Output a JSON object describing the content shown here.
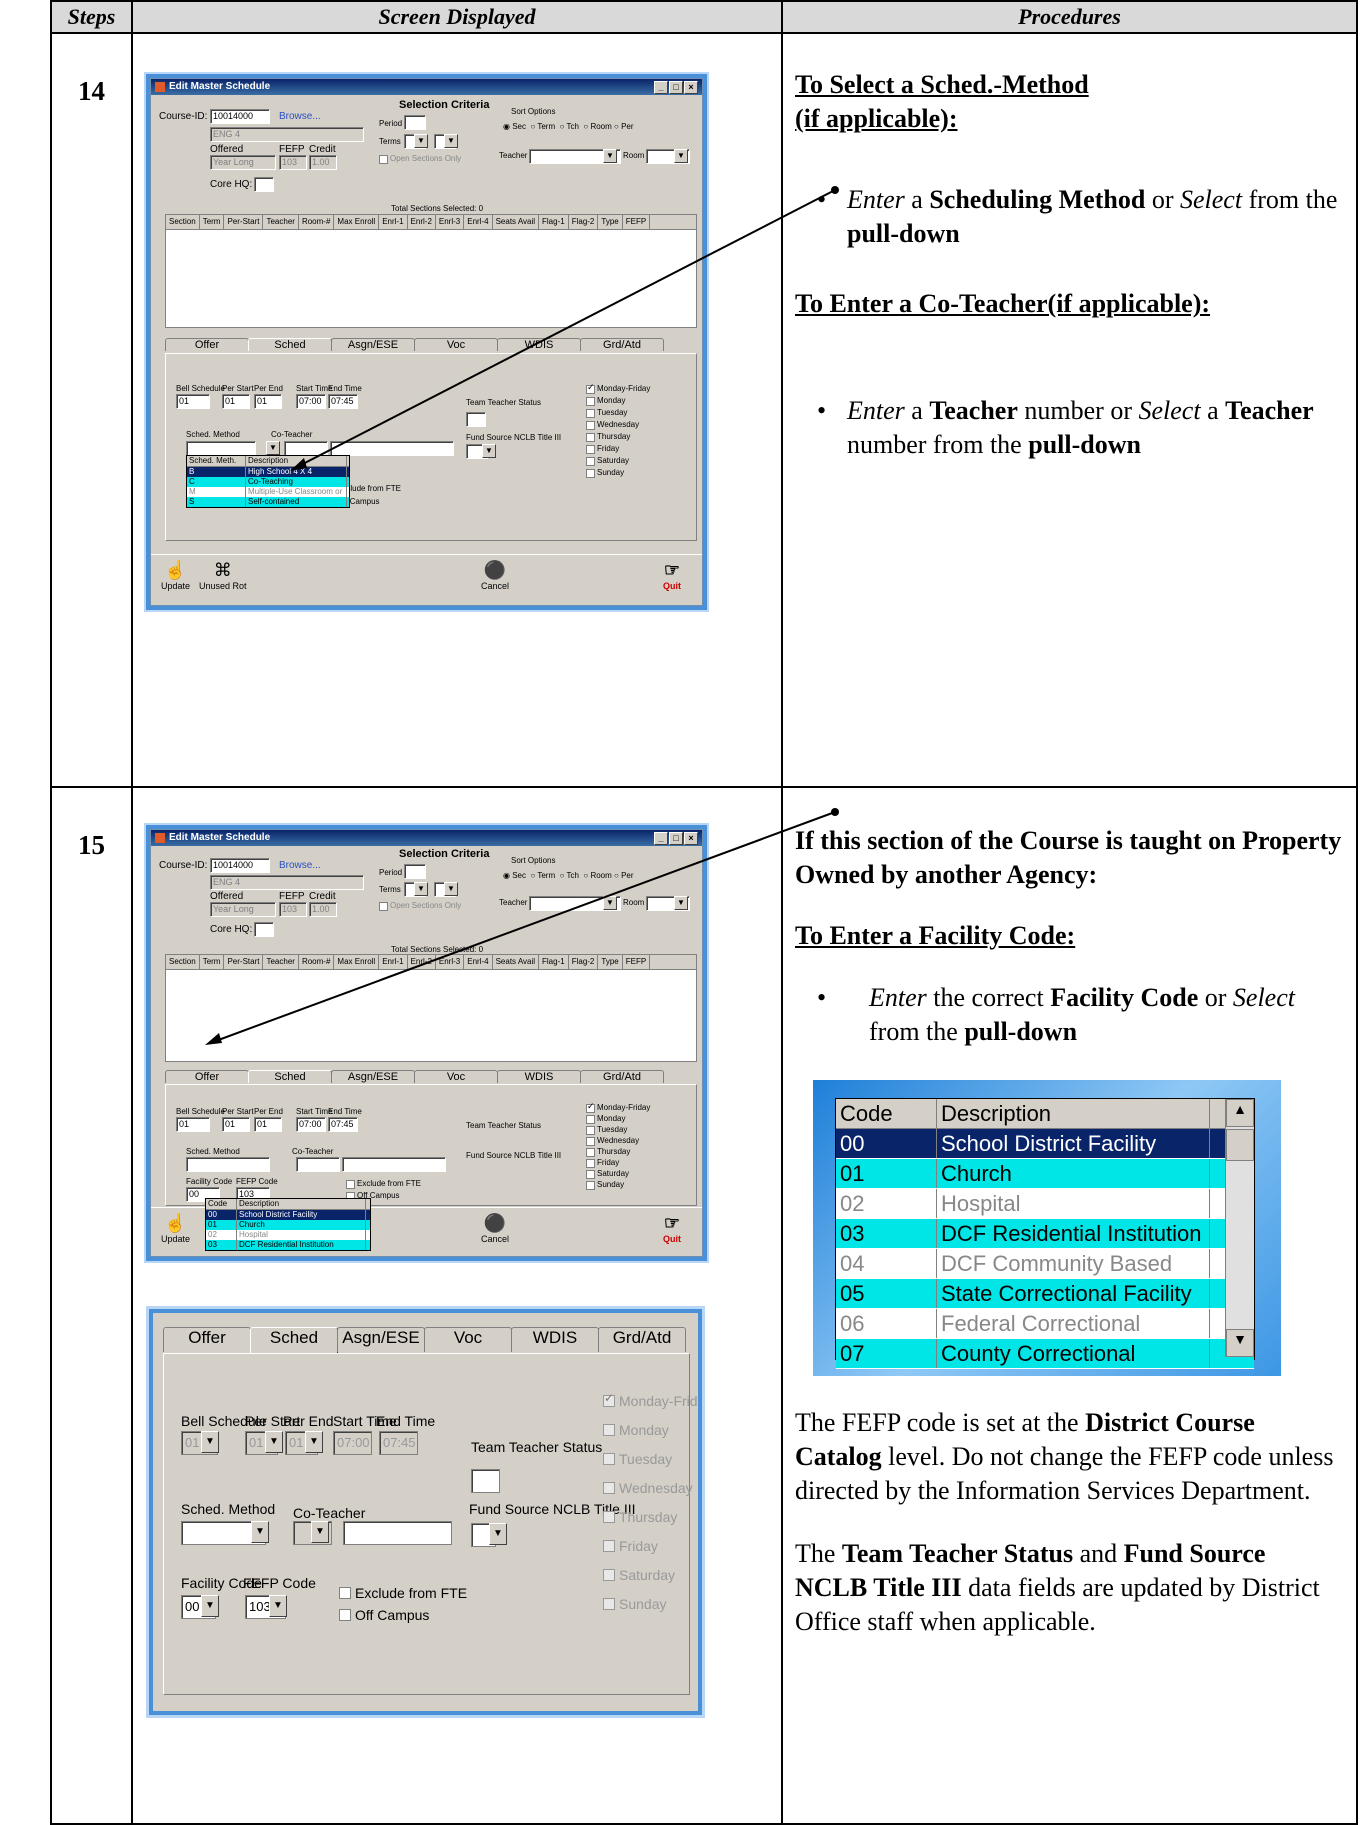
{
  "header": {
    "steps": "Steps",
    "screen": "Screen Displayed",
    "procedures": "Procedures"
  },
  "step14": {
    "number": "14",
    "heading1_a": "To Select a Sched.-Method",
    "heading1_b": "(if applicable):",
    "bullet1": {
      "enter": "Enter",
      "a": " a ",
      "field": "Scheduling Method",
      "or": " or ",
      "select": "Select",
      "rest": " from the ",
      "pulldown": "pull-down"
    },
    "heading2": "To Enter a Co-Teacher(if applicable):",
    "bullet2": {
      "enter": "Enter",
      "a": " a ",
      "field": "Teacher",
      "mid": " number or ",
      "select": "Select",
      "a2": " a ",
      "field2": "Teacher",
      "rest": " number from the ",
      "pulldown": "pull-down"
    }
  },
  "step15": {
    "number": "15",
    "intro": "If this section of the Course is taught on Property Owned by another Agency:",
    "heading": "To Enter a Facility Code:",
    "bullet": {
      "enter": "Enter",
      "mid": "  the correct ",
      "field": "Facility Code",
      "or": " or ",
      "select": "Select",
      "rest": " from the ",
      "pulldown": "pull-down"
    },
    "para1": {
      "a": "The FEFP code is set at the ",
      "b": "District Course Catalog",
      "c": " level.  Do not change the FEFP code unless directed by the Information Services Department."
    },
    "para2": {
      "a": "The ",
      "b": "Team Teacher Status",
      "c": " and ",
      "d": "Fund Source NCLB Title III",
      "e": " data fields are updated by District Office staff when applicable."
    }
  },
  "window": {
    "title": "Edit Master Schedule",
    "course_id_label": "Course-ID:",
    "course_id": "10014000",
    "browse": "Browse...",
    "course_name": "ENG 4",
    "offered_label": "Offered",
    "offered": "Year Long",
    "fefp_label": "FEFP",
    "fefp": "103",
    "credit_label": "Credit",
    "credit": "1.00",
    "core_hq": "Core HQ:",
    "selection_criteria": "Selection Criteria",
    "period": "Period",
    "terms": "Terms",
    "open_only": "Open Sections Only",
    "sort_options": "Sort Options",
    "sort": [
      "Sec",
      "Term",
      "Tch",
      "Room",
      "Per"
    ],
    "teacher": "Teacher",
    "room": "Room",
    "total_sections": "Total Sections Selected: 0",
    "columns": [
      "Section",
      "Term",
      "Per-Start",
      "Teacher",
      "Room-#",
      "Max Enroll",
      "Enrl-1",
      "Enrl-2",
      "Enrl-3",
      "Enrl-4",
      "Seats Avail",
      "Flag-1",
      "Flag-2",
      "Type",
      "FEFP"
    ],
    "tabs": [
      "Offer",
      "Sched",
      "Asgn/ESE",
      "Voc",
      "WDIS",
      "Grd/Atd"
    ],
    "bell_schedule": "Bell Schedule",
    "per_start": "Per Start",
    "per_end": "Per End",
    "start_time": "Start Time",
    "end_time": "End Time",
    "bell_val": "01",
    "per_start_val": "01",
    "per_end_val": "01",
    "start_val": "07:00",
    "end_val": "07:45",
    "team_teacher": "Team Teacher Status",
    "sched_method": "Sched. Method",
    "co_teacher": "Co-Teacher",
    "fund_source": "Fund Source NCLB Title III",
    "facility_code": "Facility Code",
    "fefp_code": "FEFP Code",
    "facility_val": "00",
    "fefp_val": "103",
    "exclude_fte": "Exclude from FTE",
    "off_campus": "Off Campus",
    "days": [
      "Monday-Friday",
      "Monday",
      "Tuesday",
      "Wednesday",
      "Thursday",
      "Friday",
      "Saturday",
      "Sunday"
    ],
    "update": "Update",
    "unused": "Unused Rot",
    "cancel": "Cancel",
    "quit": "Quit"
  },
  "sched_method_list": {
    "headers": [
      "Sched. Meth.",
      "Description"
    ],
    "rows": [
      [
        "B",
        "High School 4 X 4"
      ],
      [
        "C",
        "Co-Teaching"
      ],
      [
        "M",
        "Multiple-Use Classroom or"
      ],
      [
        "S",
        "Self-contained"
      ]
    ]
  },
  "facility_list": {
    "headers": [
      "Code",
      "Description"
    ],
    "rows": [
      [
        "00",
        "School District Facility"
      ],
      [
        "01",
        "Church"
      ],
      [
        "02",
        "Hospital"
      ],
      [
        "03",
        "DCF Residential Institution"
      ],
      [
        "04",
        "DCF Community Based"
      ],
      [
        "05",
        "State Correctional Facility"
      ],
      [
        "06",
        "Federal Correctional"
      ],
      [
        "07",
        "County Correctional"
      ]
    ]
  },
  "colors": {
    "cyan": "#00e5e5",
    "selected": "#0a246a",
    "frame": "#4a90d9"
  }
}
